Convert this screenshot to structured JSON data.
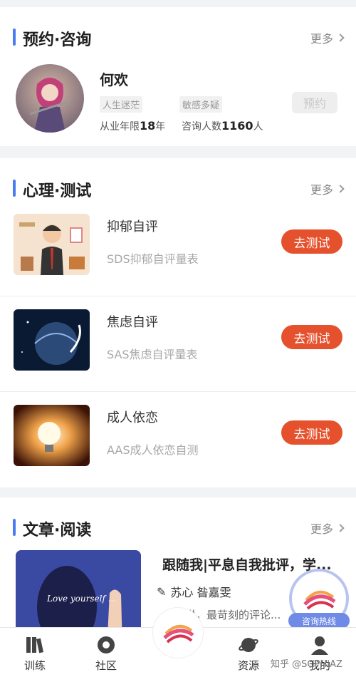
{
  "booking": {
    "title": "预约·咨询",
    "more": "更多",
    "counselor": {
      "name": "何欢",
      "tags": [
        "人生迷茫",
        "敏感多疑"
      ],
      "experience_label": "从业年限",
      "experience_value": "18",
      "experience_unit": "年",
      "consult_label": "咨询人数",
      "consult_value": "1160",
      "consult_unit": "人",
      "book_button": "预约"
    }
  },
  "tests": {
    "title": "心理·测试",
    "more": "更多",
    "items": [
      {
        "title": "抑郁自评",
        "subtitle": "SDS抑郁自评量表",
        "button": "去测试"
      },
      {
        "title": "焦虑自评",
        "subtitle": "SAS焦虑自评量表",
        "button": "去测试"
      },
      {
        "title": "成人依恋",
        "subtitle": "AAS成人依恋自测",
        "button": "去测试"
      }
    ]
  },
  "articles": {
    "title": "文章·阅读",
    "more": "更多",
    "item": {
      "title": "跟随我|平息自我批评，学...",
      "author": "苏心 昝嘉雯",
      "excerpt": "有人说，最苛刻的评论...",
      "image_text": "Love yourself ..."
    }
  },
  "hotline": {
    "label": "咨询热线"
  },
  "tabbar": {
    "items": [
      {
        "label": "训练",
        "icon": "books-icon"
      },
      {
        "label": "社区",
        "icon": "circle-icon"
      },
      {
        "label": "资源",
        "icon": "planet-icon"
      },
      {
        "label": "我的",
        "icon": "user-icon"
      }
    ]
  },
  "watermark": "知乎 @SOPHIAZ",
  "colors": {
    "accent": "#4a7cf0",
    "button": "#e5512d",
    "hotline": "#6f8ae7"
  }
}
